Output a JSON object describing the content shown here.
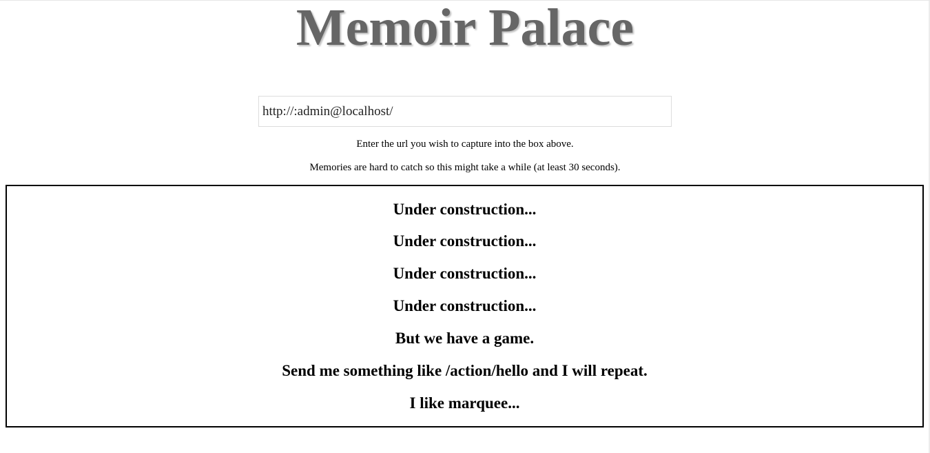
{
  "header": {
    "title": "Memoir Palace"
  },
  "capture_form": {
    "url_value": "http://:admin@localhost/",
    "url_placeholder": ""
  },
  "instructions": {
    "line_1": "Enter the url you wish to capture into the box above.",
    "line_2": "Memories are hard to catch so this might take a while (at least 30 seconds)."
  },
  "marquee": {
    "lines": [
      "Under construction...",
      "Under construction...",
      "Under construction...",
      "Under construction...",
      "But we have a game.",
      "Send me something like /action/hello and I will repeat.",
      "I like marquee..."
    ]
  }
}
